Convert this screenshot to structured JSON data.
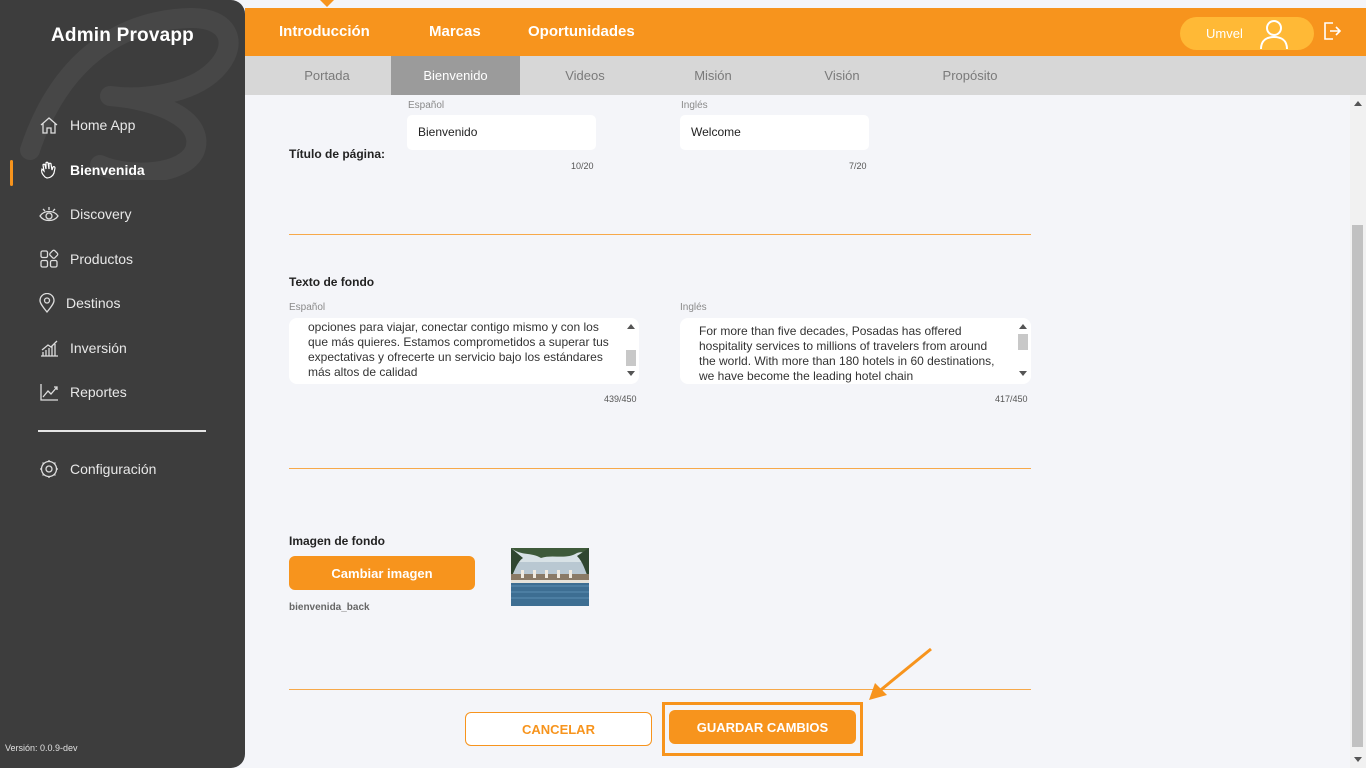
{
  "app": {
    "title": "Admin Provapp",
    "version": "Versión: 0.0.9-dev"
  },
  "sidebar": {
    "items": [
      {
        "label": "Home App",
        "icon": "home-icon"
      },
      {
        "label": "Bienvenida",
        "icon": "wave-hand-icon",
        "active": true
      },
      {
        "label": "Discovery",
        "icon": "eye-icon"
      },
      {
        "label": "Productos",
        "icon": "grid-icon"
      },
      {
        "label": "Destinos",
        "icon": "location-pin-icon"
      },
      {
        "label": "Inversión",
        "icon": "bar-chart-icon"
      },
      {
        "label": "Reportes",
        "icon": "line-chart-icon"
      }
    ],
    "settings": {
      "label": "Configuración",
      "icon": "gear-icon"
    }
  },
  "topnav": {
    "tabs": [
      "Introducción",
      "Marcas",
      "Oportunidades"
    ],
    "active_tab": "Introducción",
    "user": "Umvel"
  },
  "subtabs": {
    "items": [
      "Portada",
      "Bienvenido",
      "Videos",
      "Misión",
      "Visión",
      "Propósito"
    ],
    "active": "Bienvenido"
  },
  "form": {
    "page_title": {
      "label": "Título de página:",
      "es_label": "Español",
      "en_label": "Inglés",
      "es_value": "Bienvenido",
      "en_value": "Welcome",
      "es_counter": "10/20",
      "en_counter": "7/20"
    },
    "background_text": {
      "label": "Texto de fondo",
      "es_label": "Español",
      "en_label": "Inglés",
      "es_value": "opciones para viajar, conectar contigo mismo y con los que más quieres. Estamos comprometidos a superar tus expectativas y ofrecerte un servicio bajo los estándares más altos de calidad",
      "en_value": "For more than five decades, Posadas has offered hospitality services to millions of travelers from around the world. With more than 180 hotels in 60 destinations, we have become the leading hotel chain",
      "es_counter": "439/450",
      "en_counter": "417/450"
    },
    "background_image": {
      "label": "Imagen de fondo",
      "button": "Cambiar imagen",
      "filename": "bienvenida_back"
    },
    "actions": {
      "cancel": "CANCELAR",
      "save": "GUARDAR CAMBIOS"
    }
  },
  "colors": {
    "accent": "#f7941d",
    "sidebar": "#3d3d3d",
    "subtabs": "#d7d7d7",
    "subtab_active": "#9b9b9b"
  }
}
